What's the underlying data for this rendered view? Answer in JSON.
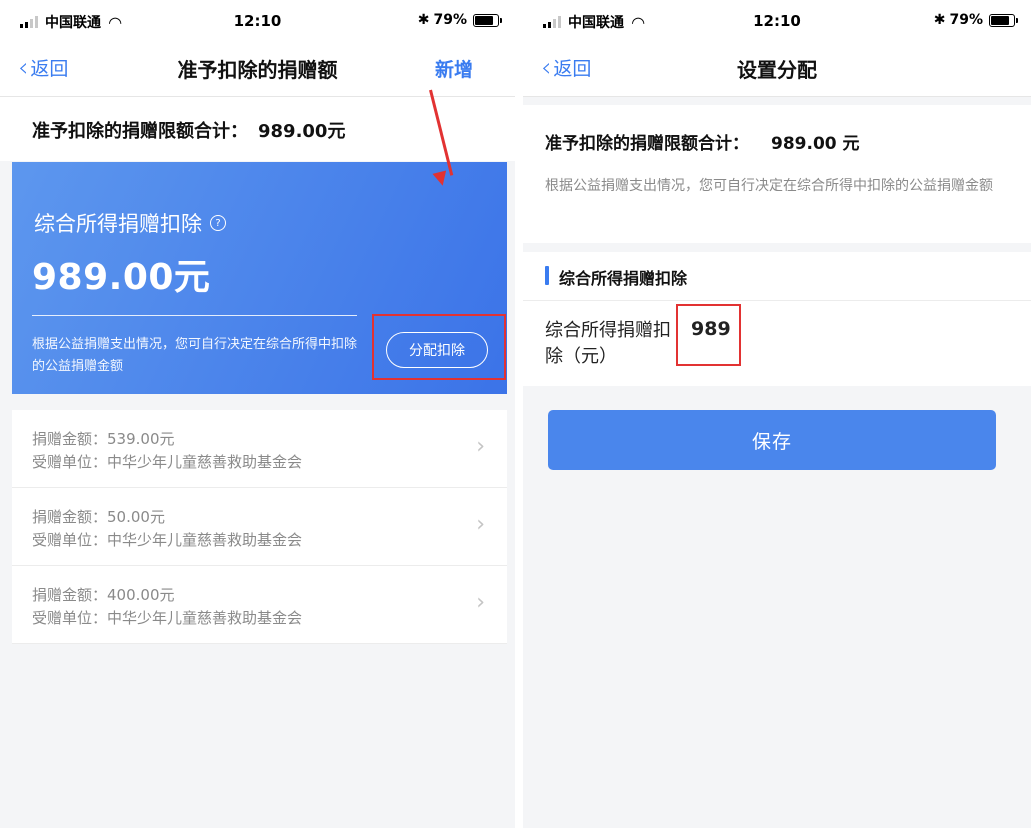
{
  "status_bar": {
    "carrier": "中国联通",
    "time": "12:10",
    "battery": "79%"
  },
  "left": {
    "nav": {
      "back_label": "返回",
      "title": "准予扣除的捐赠额",
      "action_label": "新增"
    },
    "total": {
      "label": "准予扣除的捐赠限额合计：",
      "value": "989.00元"
    },
    "card": {
      "title": "综合所得捐赠扣除",
      "amount": "989.00元",
      "description": "根据公益捐赠支出情况，您可自行决定在综合所得中扣除的公益捐赠金额",
      "button_label": "分配扣除"
    },
    "donations": [
      {
        "amount": "捐赠金额：539.00元",
        "recipient": "受赠单位：中华少年儿童慈善救助基金会"
      },
      {
        "amount": "捐赠金额：50.00元",
        "recipient": "受赠单位：中华少年儿童慈善救助基金会"
      },
      {
        "amount": "捐赠金额：400.00元",
        "recipient": "受赠单位：中华少年儿童慈善救助基金会"
      }
    ]
  },
  "right": {
    "nav": {
      "back_label": "返回",
      "title": "设置分配"
    },
    "total": {
      "label": "准予扣除的捐赠限额合计：",
      "value": "989.00 元"
    },
    "description": "根据公益捐赠支出情况，您可自行决定在综合所得中扣除的公益捐赠金额",
    "section_title": "综合所得捐赠扣除",
    "field": {
      "label": "综合所得捐赠扣除（元）",
      "value": "989"
    },
    "save_label": "保存"
  },
  "colors": {
    "accent": "#3a7cf0",
    "highlight": "#e23232",
    "save_button": "#4a86ec"
  },
  "icons": {
    "help": "question-circle-icon",
    "chevron": "chevron-right-icon",
    "back": "chevron-left-icon"
  }
}
